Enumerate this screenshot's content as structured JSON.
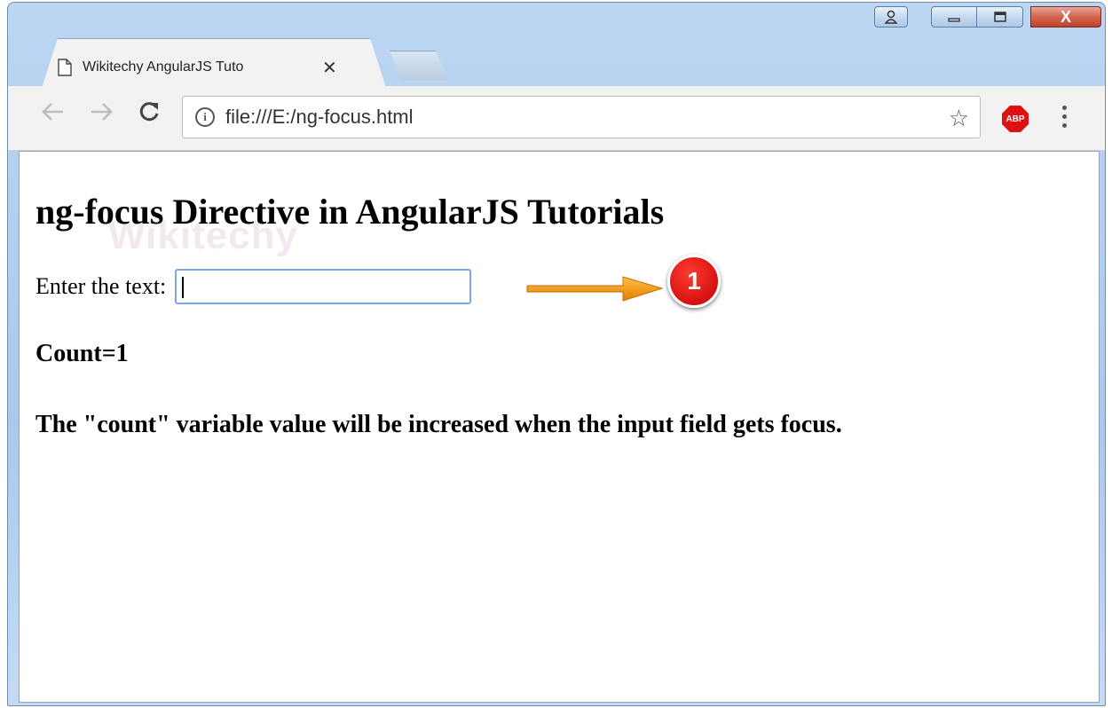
{
  "browser": {
    "tab": {
      "title": "Wikitechy AngularJS Tuto",
      "close_glyph": "✕"
    },
    "window_controls": {
      "close_glyph": "X"
    },
    "address_bar": {
      "url": "file:///E:/ng-focus.html",
      "info_glyph": "i"
    },
    "toolbar": {
      "back_icon": "arrow-left-icon",
      "forward_icon": "arrow-right-icon",
      "reload_icon": "reload-icon",
      "star_icon": "bookmark-star-icon",
      "extension_label": "ABP"
    }
  },
  "page": {
    "watermark": "Wikitechy",
    "heading": "ng-focus Directive in AngularJS Tutorials",
    "input_label": "Enter the text:",
    "input_value": "",
    "annotation_badge": "1",
    "count_text": "Count=1",
    "description": "The \"count\" variable value will be increased when the input field gets focus."
  },
  "colors": {
    "arrow": "#f39019",
    "badge": "#e00000",
    "input_focus_border": "#7ea6e8"
  }
}
